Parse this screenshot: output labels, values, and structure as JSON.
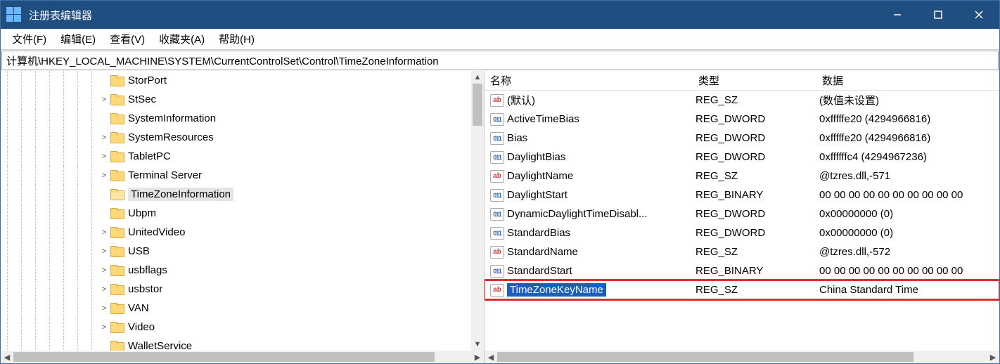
{
  "window": {
    "title": "注册表编辑器"
  },
  "menu": {
    "file": "文件(F)",
    "edit": "编辑(E)",
    "view": "查看(V)",
    "favorites": "收藏夹(A)",
    "help": "帮助(H)"
  },
  "address": "计算机\\HKEY_LOCAL_MACHINE\\SYSTEM\\CurrentControlSet\\Control\\TimeZoneInformation",
  "tree": [
    {
      "label": "StorPort",
      "depth": 8,
      "expander": ""
    },
    {
      "label": "StSec",
      "depth": 8,
      "expander": ">"
    },
    {
      "label": "SystemInformation",
      "depth": 8,
      "expander": ""
    },
    {
      "label": "SystemResources",
      "depth": 8,
      "expander": ">"
    },
    {
      "label": "TabletPC",
      "depth": 8,
      "expander": ">"
    },
    {
      "label": "Terminal Server",
      "depth": 8,
      "expander": ">"
    },
    {
      "label": "TimeZoneInformation",
      "depth": 8,
      "expander": "",
      "selected": true,
      "open": true
    },
    {
      "label": "Ubpm",
      "depth": 8,
      "expander": ""
    },
    {
      "label": "UnitedVideo",
      "depth": 8,
      "expander": ">"
    },
    {
      "label": "USB",
      "depth": 8,
      "expander": ">"
    },
    {
      "label": "usbflags",
      "depth": 8,
      "expander": ">"
    },
    {
      "label": "usbstor",
      "depth": 8,
      "expander": ">"
    },
    {
      "label": "VAN",
      "depth": 8,
      "expander": ">"
    },
    {
      "label": "Video",
      "depth": 8,
      "expander": ">"
    },
    {
      "label": "WalletService",
      "depth": 8,
      "expander": ""
    }
  ],
  "columns": {
    "name": "名称",
    "type": "类型",
    "data": "数据"
  },
  "values": [
    {
      "name": "(默认)",
      "type": "REG_SZ",
      "data": "(数值未设置)",
      "kind": "sz"
    },
    {
      "name": "ActiveTimeBias",
      "type": "REG_DWORD",
      "data": "0xfffffe20 (4294966816)",
      "kind": "bin"
    },
    {
      "name": "Bias",
      "type": "REG_DWORD",
      "data": "0xfffffe20 (4294966816)",
      "kind": "bin"
    },
    {
      "name": "DaylightBias",
      "type": "REG_DWORD",
      "data": "0xffffffc4 (4294967236)",
      "kind": "bin"
    },
    {
      "name": "DaylightName",
      "type": "REG_SZ",
      "data": "@tzres.dll,-571",
      "kind": "sz"
    },
    {
      "name": "DaylightStart",
      "type": "REG_BINARY",
      "data": "00 00 00 00 00 00 00 00 00 00",
      "kind": "bin"
    },
    {
      "name": "DynamicDaylightTimeDisabl...",
      "type": "REG_DWORD",
      "data": "0x00000000 (0)",
      "kind": "bin"
    },
    {
      "name": "StandardBias",
      "type": "REG_DWORD",
      "data": "0x00000000 (0)",
      "kind": "bin"
    },
    {
      "name": "StandardName",
      "type": "REG_SZ",
      "data": "@tzres.dll,-572",
      "kind": "sz"
    },
    {
      "name": "StandardStart",
      "type": "REG_BINARY",
      "data": "00 00 00 00 00 00 00 00 00 00",
      "kind": "bin"
    },
    {
      "name": "TimeZoneKeyName",
      "type": "REG_SZ",
      "data": "China Standard Time",
      "kind": "sz",
      "highlighted": true
    }
  ]
}
